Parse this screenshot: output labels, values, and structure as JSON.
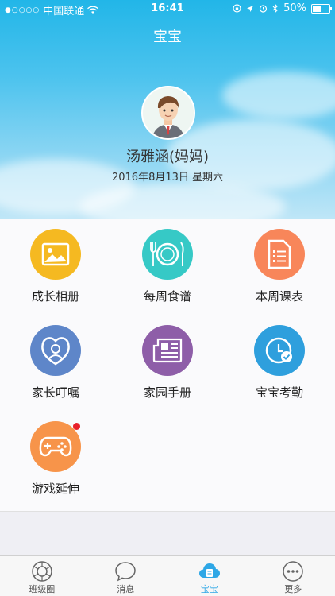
{
  "status_bar": {
    "signal": "●○○○○",
    "carrier": "中国联通",
    "time": "16:41",
    "battery_percent": "50%",
    "battery_level": 0.5
  },
  "header": {
    "title": "宝宝",
    "user_name": "汤雅涵(妈妈)",
    "date": "2016年8月13日 星期六"
  },
  "grid": {
    "items": [
      {
        "label": "成长相册",
        "color": "#f5b921",
        "icon": "photo-album-icon"
      },
      {
        "label": "每周食谱",
        "color": "#36c9c6",
        "icon": "plate-utensils-icon"
      },
      {
        "label": "本周课表",
        "color": "#f8865a",
        "icon": "document-list-icon"
      },
      {
        "label": "家长叮嘱",
        "color": "#5e86c9",
        "icon": "heart-person-icon"
      },
      {
        "label": "家园手册",
        "color": "#8e5ea8",
        "icon": "newspaper-icon"
      },
      {
        "label": "宝宝考勤",
        "color": "#2e9fdd",
        "icon": "clock-check-icon"
      },
      {
        "label": "游戏延伸",
        "color": "#f7944a",
        "icon": "gamepad-icon",
        "has_badge": true
      }
    ]
  },
  "tabbar": {
    "tabs": [
      {
        "label": "班级圈",
        "icon": "camera-aperture-icon",
        "active": false
      },
      {
        "label": "消息",
        "icon": "chat-bubble-icon",
        "active": false
      },
      {
        "label": "宝宝",
        "icon": "baby-cloud-icon",
        "active": true
      },
      {
        "label": "更多",
        "icon": "more-dots-icon",
        "active": false
      }
    ]
  },
  "colors": {
    "accent": "#2ea7e6",
    "badge": "#e8202a"
  }
}
